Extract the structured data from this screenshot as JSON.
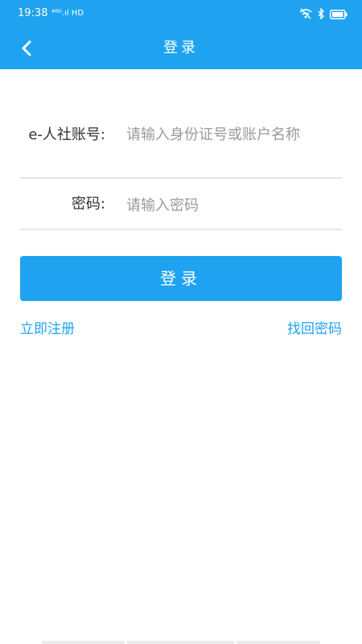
{
  "status_bar": {
    "time": "19:38",
    "signal": "⁴⁶ᴳ.ıl HD",
    "icons": [
      "wifi-off-icon",
      "bluetooth-icon",
      "battery-icon"
    ]
  },
  "header": {
    "title": "登录",
    "back_icon": "chevron-left-icon"
  },
  "form": {
    "account_label": "e-人社账号:",
    "account_placeholder": "请输入身份证号或账户名称",
    "account_value": "",
    "password_label": "密码:",
    "password_placeholder": "请输入密码",
    "password_value": ""
  },
  "login_button": "登录",
  "links": {
    "register": "立即注册",
    "forgot": "找回密码"
  },
  "colors": {
    "primary": "#1fa3f0",
    "placeholder": "#9a9a9a",
    "label": "#333333",
    "divider": "#e6e6e6"
  }
}
